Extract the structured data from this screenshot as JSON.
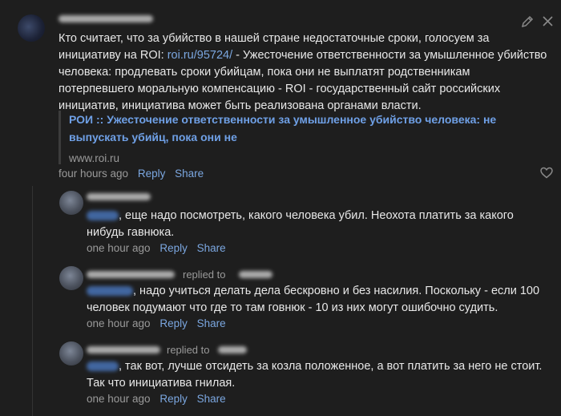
{
  "main_comment": {
    "text_before_link": "Кто считает, что за убийство в нашей стране недостаточные сроки, голосуем за инициативу на ROI: ",
    "link_text": "roi.ru/95724/",
    "text_after_link": " - Ужесточение ответственности за умышленное убийство человека: продлевать сроки убийцам, пока они не выплатят родственникам потерпевшего моральную компенсацию - ROI - государственный сайт российских инициатив, инициатива может быть реализована органами власти.",
    "preview_title": "РОИ :: Ужесточение ответственности за умышленное убийство человека: не выпускать убийц, пока они не",
    "preview_domain": "www.roi.ru",
    "time": "four hours ago",
    "reply_label": "Reply",
    "share_label": "Share"
  },
  "replies": [
    {
      "replied_to_label": "",
      "text": ", еще надо посмотреть, какого человека убил. Неохота платить за какого нибудь гавнюка.",
      "time": "one hour ago",
      "reply_label": "Reply",
      "share_label": "Share"
    },
    {
      "replied_to_label": "replied to",
      "text": ", надо учиться делать дела бескровно и без насилия. Поскольку - если 100 человек подумают что где то там говнюк - 10 из них могут ошибочно судить.",
      "time": "one hour ago",
      "reply_label": "Reply",
      "share_label": "Share"
    },
    {
      "replied_to_label": "replied to",
      "text": ", так вот, лучше отсидеть за козла положенное, а вот платить за него не стоит. Так что инициатива гнилая.",
      "time": "one hour ago",
      "reply_label": "Reply",
      "share_label": "Share"
    }
  ],
  "icons": {
    "edit": "pencil-icon",
    "close": "close-icon",
    "like": "heart-icon"
  }
}
